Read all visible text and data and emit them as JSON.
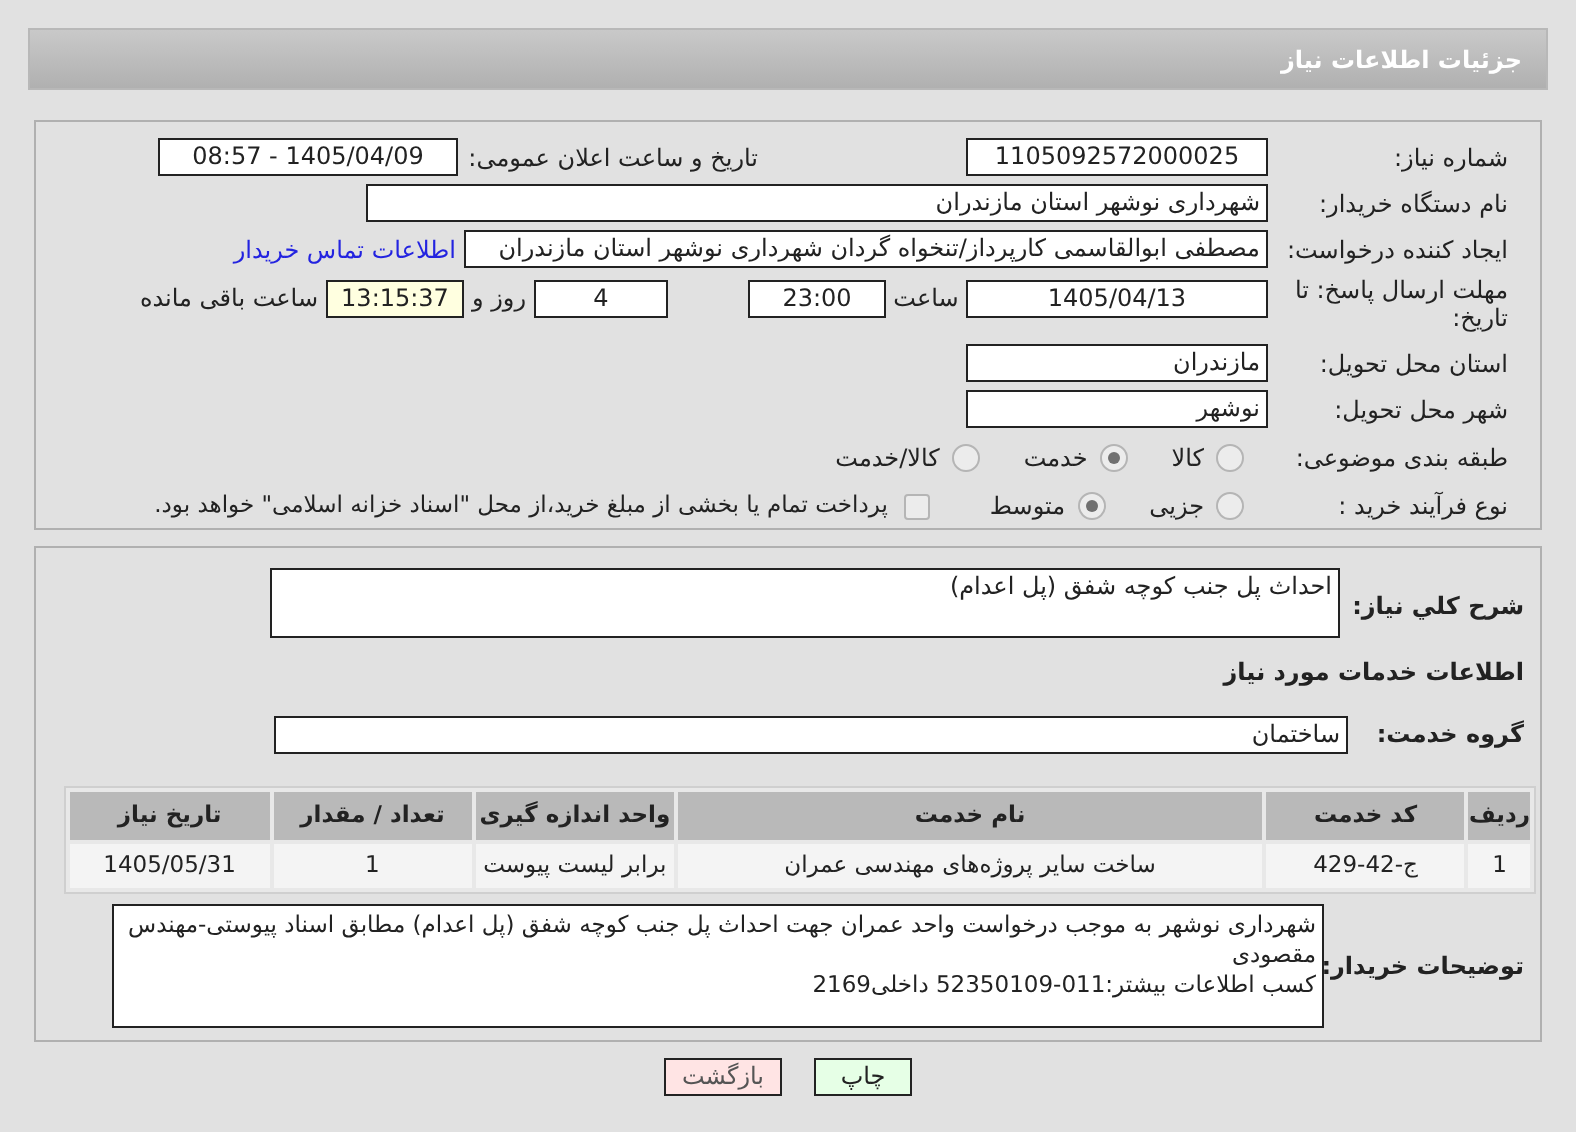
{
  "title": "جزئیات اطلاعات نیاز",
  "need_number": {
    "label": "شماره نیاز:",
    "value": "1105092572000025"
  },
  "announce": {
    "label": "تاریخ و ساعت اعلان عمومی:",
    "value": "1405/04/09 - 08:57"
  },
  "buyer": {
    "label": "نام دستگاه خریدار:",
    "value": "شهرداری نوشهر استان مازندران"
  },
  "requester": {
    "label": "ایجاد کننده درخواست:",
    "value": "مصطفی  ابوالقاسمی کارپرداز/تنخواه گردان شهرداری نوشهر استان مازندران",
    "link": "اطلاعات تماس خریدار"
  },
  "deadline": {
    "label": "مهلت ارسال پاسخ: تا تاریخ:",
    "date": "1405/04/13",
    "time_label": "ساعت",
    "time": "23:00",
    "days": "4",
    "days_label": "روز و",
    "remaining": "13:15:37",
    "remaining_label": "ساعت باقی مانده"
  },
  "province": {
    "label": "استان محل تحویل:",
    "value": "مازندران"
  },
  "city": {
    "label": "شهر محل تحویل:",
    "value": "نوشهر"
  },
  "category": {
    "label": "طبقه بندی موضوعی:",
    "options": [
      {
        "label": "کالا",
        "selected": false
      },
      {
        "label": "خدمت",
        "selected": true
      },
      {
        "label": "کالا/خدمت",
        "selected": false
      }
    ]
  },
  "process": {
    "label": "نوع فرآیند خرید :",
    "options": [
      {
        "label": "جزیی",
        "selected": false
      },
      {
        "label": "متوسط",
        "selected": true
      }
    ],
    "payment": {
      "checked": false,
      "text": "پرداخت تمام یا بخشی از مبلغ خرید،از محل \"اسناد خزانه اسلامی\" خواهد بود."
    }
  },
  "summary": {
    "label": "شرح کلي نياز:",
    "value": "احداث پل جنب کوچه شفق (پل اعدام)"
  },
  "services_heading": "اطلاعات خدمات مورد نیاز",
  "group": {
    "label": "گروه خدمت:",
    "value": "ساختمان"
  },
  "table": {
    "columns": [
      "ردیف",
      "کد خدمت",
      "نام خدمت",
      "واحد اندازه گیری",
      "تعداد / مقدار",
      "تاریخ نیاز"
    ],
    "rows": [
      [
        "1",
        "ج-42-429",
        "ساخت سایر پروژه‌های مهندسی عمران",
        "برابر لیست پیوست",
        "1",
        "1405/05/31"
      ]
    ]
  },
  "notes": {
    "label": "توضیحات خریدار:",
    "value": "شهرداری نوشهر به موجب درخواست واحد عمران جهت احداث پل جنب کوچه شفق (پل اعدام) مطابق اسناد پیوستی-مهندس مقصودی\nکسب اطلاعات بیشتر:011-52350109 داخلی2169"
  },
  "buttons": [
    {
      "label": "چاپ",
      "kind": "print"
    },
    {
      "label": "بازگشت",
      "kind": "back"
    }
  ]
}
